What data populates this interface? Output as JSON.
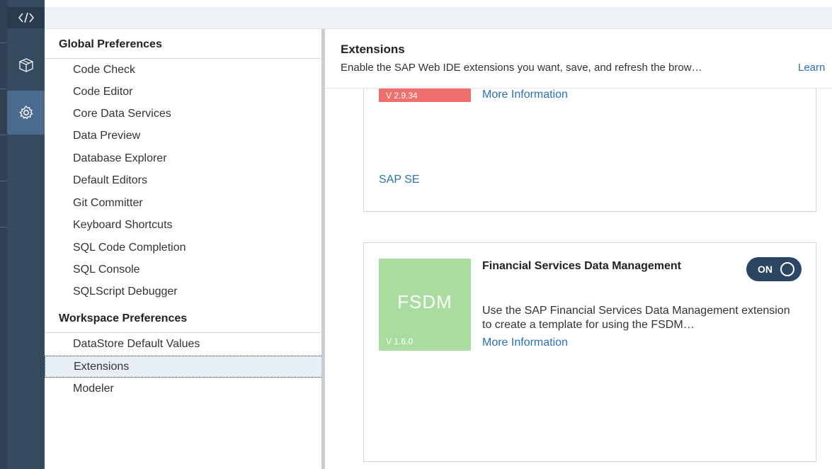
{
  "rail": {
    "icons": [
      "code-icon",
      "package-icon",
      "settings-icon"
    ]
  },
  "preferences": {
    "global_heading": "Global Preferences",
    "global_items": [
      "Code Check",
      "Code Editor",
      "Core Data Services",
      "Data Preview",
      "Database Explorer",
      "Default Editors",
      "Git Committer",
      "Keyboard Shortcuts",
      "SQL Code Completion",
      "SQL Console",
      "SQLScript Debugger"
    ],
    "workspace_heading": "Workspace Preferences",
    "workspace_items": [
      "DataStore Default Values",
      "Extensions",
      "Modeler"
    ],
    "selected": "Extensions"
  },
  "content": {
    "title": "Extensions",
    "description": "Enable the SAP Web IDE extensions you want, save, and refresh the brow…",
    "learn_link": "Learn",
    "extensions": [
      {
        "tile_version": "V 2.9.34",
        "tile_color": "#f07070",
        "more_info": "More Information",
        "vendor": "SAP SE"
      },
      {
        "tile_name": "FSDM",
        "tile_version": "V 1.6.0",
        "tile_color": "#a9dda0",
        "name": "Financial Services Data Management",
        "toggle": "ON",
        "description": "Use the SAP Financial Services Data Management extension to create a template for using the FSDM…",
        "more_info": "More Information"
      }
    ]
  },
  "colors": {
    "rail": "#354a5f",
    "selected_rail": "#4a6b8e",
    "link": "#2a6fb5",
    "toggle_on": "#2c4563"
  }
}
